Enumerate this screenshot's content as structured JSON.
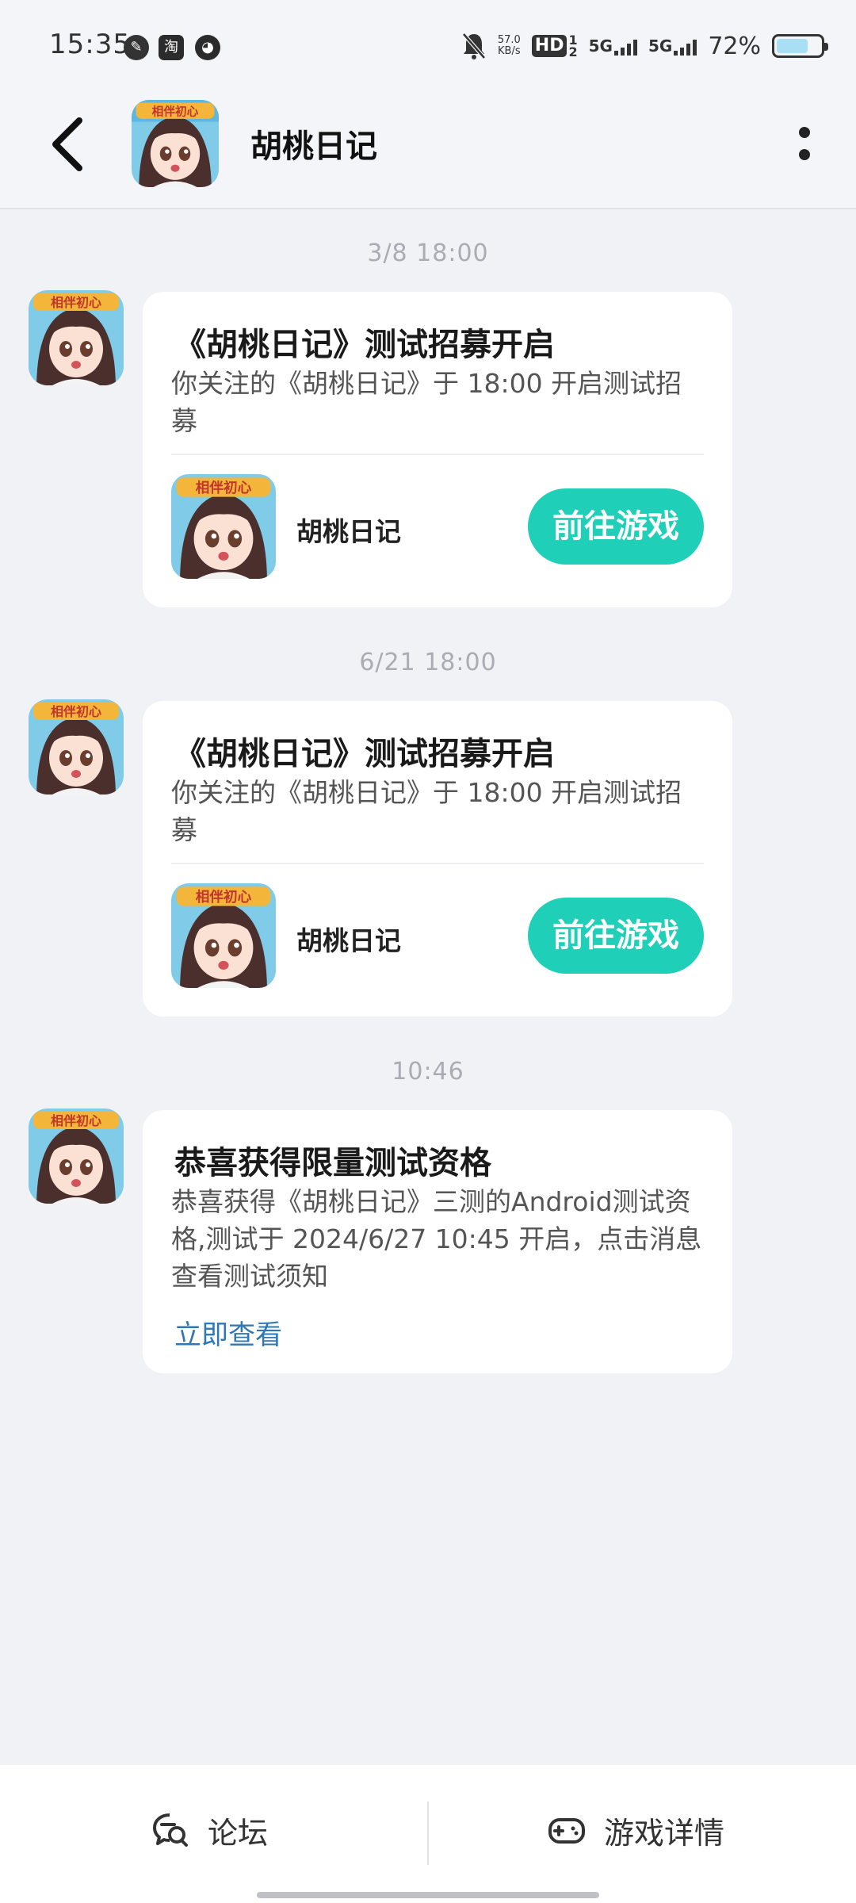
{
  "status_bar": {
    "time": "15:35",
    "app_icon_label": "淘",
    "net_speed_value": "57.0",
    "net_speed_unit": "KB/s",
    "hd_label": "HD",
    "hd_sub": "1",
    "hd_sub2": "2",
    "sim1_label": "5G",
    "sim2_label": "5G",
    "battery_percent": "72%",
    "battery_level": 0.72
  },
  "header": {
    "title": "胡桃日记"
  },
  "messages": [
    {
      "timestamp": "3/8  18:00",
      "title": "《胡桃日记》测试招募开启",
      "body": "你关注的《胡桃日记》于 18:00 开启测试招募",
      "game_name": "胡桃日记",
      "button_label": "前往游戏"
    },
    {
      "timestamp": "6/21  18:00",
      "title": "《胡桃日记》测试招募开启",
      "body": "你关注的《胡桃日记》于 18:00 开启测试招募",
      "game_name": "胡桃日记",
      "button_label": "前往游戏"
    },
    {
      "timestamp": "10:46",
      "title": "恭喜获得限量测试资格",
      "body": "恭喜获得《胡桃日记》三测的Android测试资格,测试于 2024/6/27 10:45 开启，点击消息查看测试须知",
      "link_label": "立即查看"
    }
  ],
  "bottom_nav": {
    "forum_label": "论坛",
    "game_detail_label": "游戏详情"
  },
  "colors": {
    "accent_button": "#1fcfb7",
    "link": "#2f78b5",
    "background": "#f1f2f6"
  },
  "icons": {
    "back": "chevron-left-icon",
    "more": "more-vertical-icon",
    "forum": "chat-search-icon",
    "game_detail": "gamepad-icon"
  }
}
